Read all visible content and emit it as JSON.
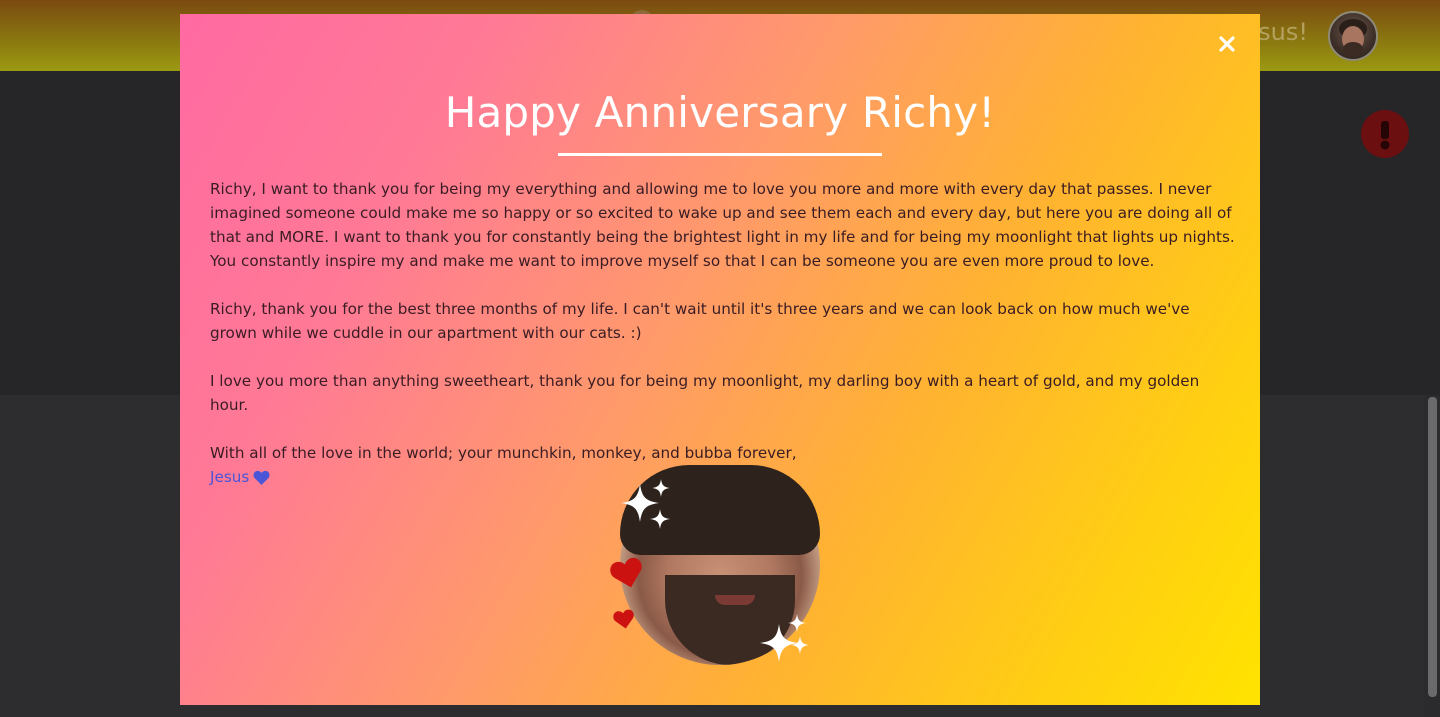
{
  "topbar": {
    "greeting": "esus!"
  },
  "modal": {
    "close_label": "×",
    "title": "Happy Anniversary Richy!",
    "paragraphs": {
      "p1": "Richy, I want to thank you for being my everything and allowing me to love you more and more with every day that passes. I never imagined someone could make me so happy or so excited to wake up and see them each and every day, but here you are doing all of that and MORE. I want to thank you for constantly being the brightest light in my life and for being my moonlight that lights up nights. You constantly inspire my and make me want to improve myself so that I can be someone you are even more proud to love.",
      "p2": "Richy, thank you for the best three months of my life. I can't wait until it's three years and we can look back on how much we've grown while we cuddle in our apartment with our cats. :)",
      "p3": "I love you more than anything sweetheart, thank you for being my moonlight, my darling boy with a heart of gold, and my golden hour.",
      "p4": "With all of the love in the world; your munchkin, monkey, and bubba forever,"
    },
    "signature": "Jesus"
  },
  "colors": {
    "signature": "#4a55d8",
    "heart": "#cc1111",
    "alert": "#6b0f10"
  },
  "icons": {
    "close": "close-icon",
    "signature_heart": "heart-icon",
    "alert": "exclamation-icon",
    "decor": [
      "sparkle-icon",
      "heart-icon"
    ]
  }
}
